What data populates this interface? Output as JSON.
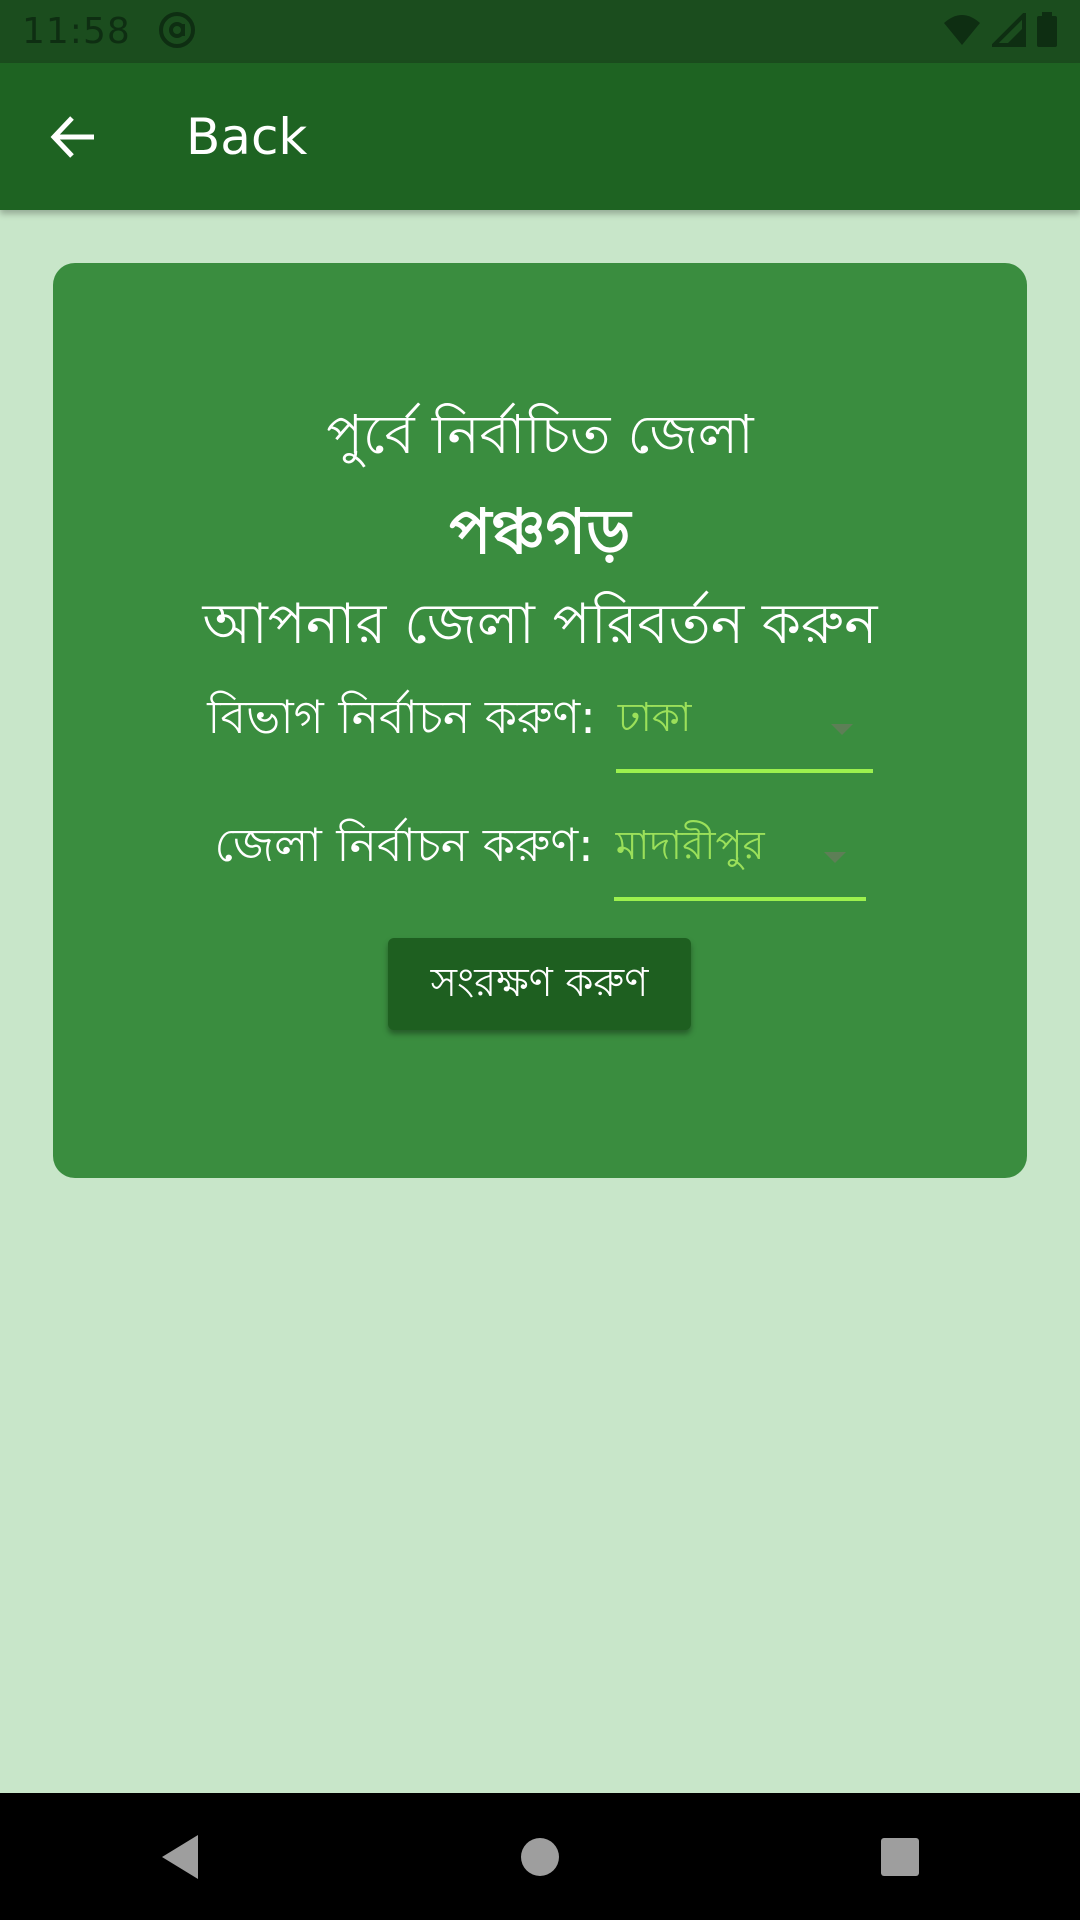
{
  "status_bar": {
    "time": "11:58",
    "icons": [
      "at-sign-icon",
      "wifi-icon",
      "signal-icon",
      "battery-icon"
    ]
  },
  "app_bar": {
    "back_icon": "arrow-left-icon",
    "title": "Back",
    "color": "#1e6322"
  },
  "card": {
    "previous_label": "পুর্বে নির্বাচিত জেলা",
    "previous_district": "পঞ্চগড়",
    "change_prompt": "আপনার জেলা পরিবর্তন করুন",
    "division_label": "বিভাগ নির্বাচন করুণ:",
    "division_value": "ঢাকা",
    "district_label": "জেলা নির্বাচন করুণ:",
    "district_value": "মাদারীপুর",
    "save_label": "সংরক্ষণ করুণ",
    "background": "#3a8d3f",
    "accent": "#9cf14e"
  },
  "nav_bar": {
    "icons": [
      "back-triangle-icon",
      "home-circle-icon",
      "recents-square-icon"
    ]
  },
  "page_background": "#c8e6c9"
}
